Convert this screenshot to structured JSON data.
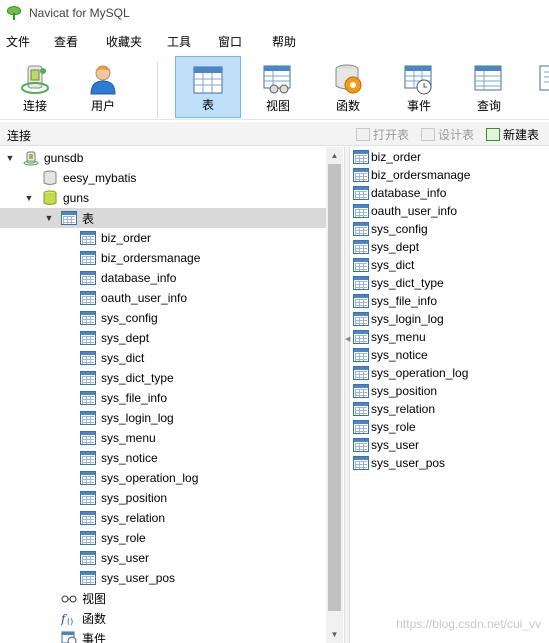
{
  "window": {
    "title": "Navicat for MySQL"
  },
  "menu": [
    "文件",
    "查看",
    "收藏夹",
    "工具",
    "窗口",
    "帮助"
  ],
  "toolbar": [
    {
      "label": "连接",
      "icon": "connection-icon"
    },
    {
      "label": "用户",
      "icon": "user-icon"
    },
    {
      "label": "表",
      "icon": "table-icon",
      "active": true
    },
    {
      "label": "视图",
      "icon": "view-icon"
    },
    {
      "label": "函数",
      "icon": "function-icon"
    },
    {
      "label": "事件",
      "icon": "event-icon"
    },
    {
      "label": "查询",
      "icon": "query-icon"
    }
  ],
  "connection_header": {
    "title": "连接",
    "open_table": "打开表",
    "design_table": "设计表",
    "new_table": "新建表"
  },
  "tree": {
    "connection": "gunsdb",
    "databases": [
      "eesy_mybatis",
      "guns"
    ],
    "tables_node": "表",
    "views_node": "视图",
    "functions_node": "函数",
    "events_node": "事件"
  },
  "tables": [
    "biz_order",
    "biz_ordersmanage",
    "database_info",
    "oauth_user_info",
    "sys_config",
    "sys_dept",
    "sys_dict",
    "sys_dict_type",
    "sys_file_info",
    "sys_login_log",
    "sys_menu",
    "sys_notice",
    "sys_operation_log",
    "sys_position",
    "sys_relation",
    "sys_role",
    "sys_user",
    "sys_user_pos"
  ],
  "watermark": "https://blog.csdn.net/cui_vv",
  "colors": {
    "selected_tool": "#bfe0f8",
    "selected_row": "#d9d9d9",
    "accent": "#4a86c6"
  }
}
